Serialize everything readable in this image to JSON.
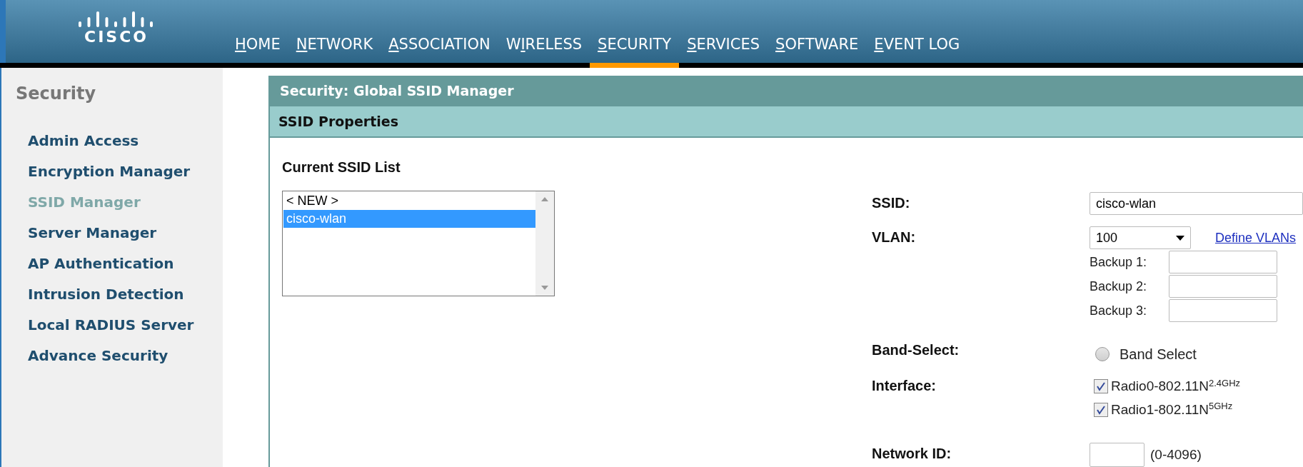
{
  "logo": {
    "text": "CISCO"
  },
  "nav": [
    {
      "key": "H",
      "post": "OME",
      "selected": false
    },
    {
      "key": "N",
      "post": "ETWORK",
      "selected": false
    },
    {
      "key": "A",
      "post": "SSOCIATION",
      "selected": false
    },
    {
      "pre": "W",
      "key": "I",
      "post": "RELESS",
      "selected": false
    },
    {
      "key": "S",
      "post": "ECURITY",
      "selected": true
    },
    {
      "key": "S",
      "post": "ERVICES",
      "selected": false
    },
    {
      "key": "S",
      "post": "OFTWARE",
      "selected": false
    },
    {
      "key": "E",
      "post": "VENT LOG",
      "selected": false
    }
  ],
  "sidebar": {
    "title": "Security",
    "items": [
      {
        "label": "Admin Access",
        "selected": false
      },
      {
        "label": "Encryption Manager",
        "selected": false
      },
      {
        "label": "SSID Manager",
        "selected": true
      },
      {
        "label": "Server Manager",
        "selected": false
      },
      {
        "label": "AP Authentication",
        "selected": false
      },
      {
        "label": "Intrusion Detection",
        "selected": false
      },
      {
        "label": "Local RADIUS Server",
        "selected": false
      },
      {
        "label": "Advance Security",
        "selected": false
      }
    ]
  },
  "panel": {
    "title": "Security: Global SSID Manager",
    "section": "SSID Properties",
    "list_label": "Current SSID List",
    "ssid_list": [
      {
        "label": "< NEW >",
        "selected": false
      },
      {
        "label": "cisco-wlan",
        "selected": true
      }
    ]
  },
  "form": [
    {
      "kind": "text",
      "label": "SSID:",
      "value": "cisco-wlan"
    },
    {
      "kind": "vlan",
      "label": "VLAN:",
      "value": "100",
      "link": "Define VLANs",
      "backups": [
        {
          "label": "Backup 1:"
        },
        {
          "label": "Backup 2:"
        },
        {
          "label": "Backup 3:"
        }
      ]
    },
    {
      "kind": "radio",
      "label": "Band-Select:",
      "option": "Band Select",
      "selected": false
    },
    {
      "kind": "checks",
      "label": "Interface:",
      "options": [
        {
          "text": "Radio0-802.11N$^{2.4GHz}$",
          "checked": true
        },
        {
          "text": "Radio1-802.11N$^{5GHz}$",
          "checked": true
        }
      ]
    },
    {
      "kind": "number",
      "label": "Network ID:",
      "hint": "(0-4096)"
    }
  ]
}
